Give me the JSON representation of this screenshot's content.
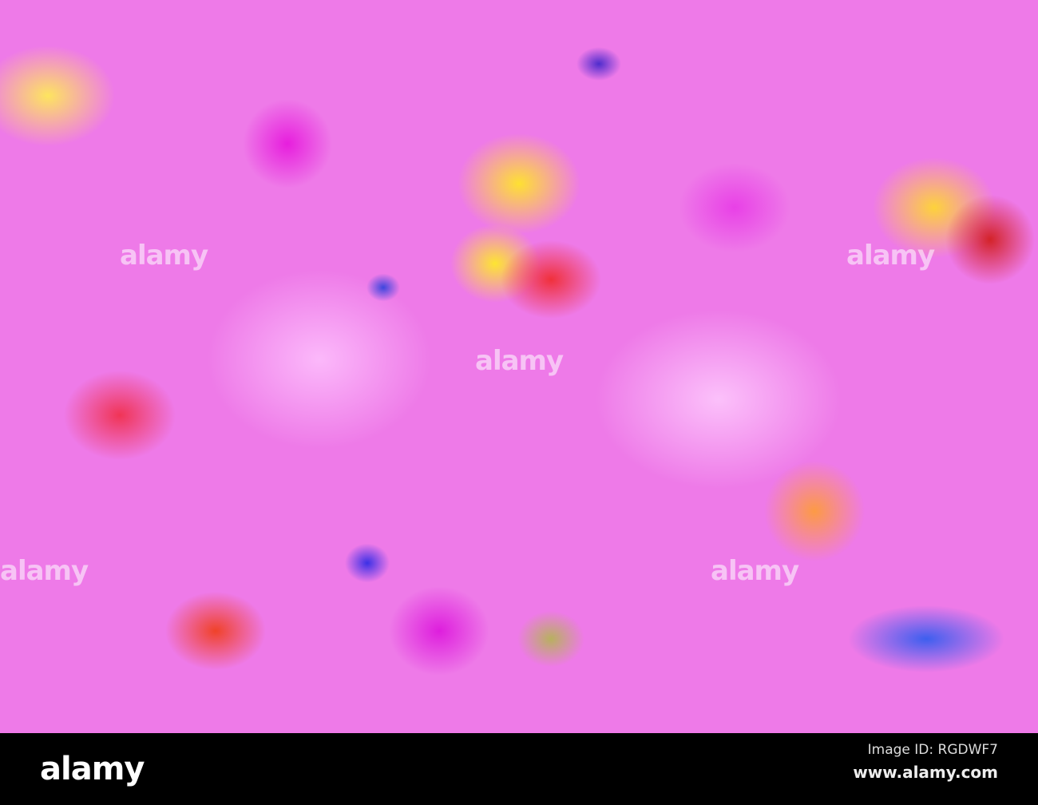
{
  "watermark": "alamy",
  "footer": {
    "logo": "alamy",
    "image_id": "Image ID: RGDWF7",
    "website": "www.alamy.com"
  }
}
